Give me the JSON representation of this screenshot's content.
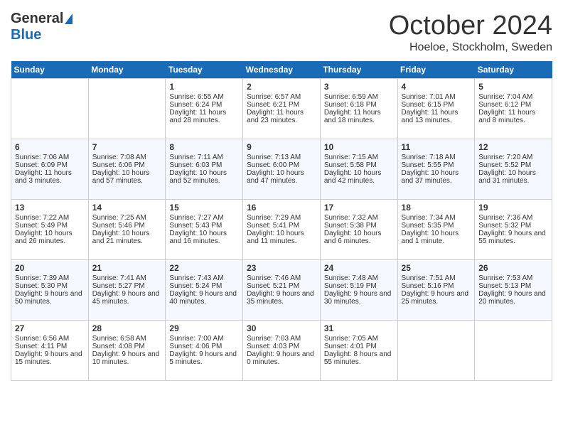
{
  "header": {
    "logo_general": "General",
    "logo_blue": "Blue",
    "month": "October 2024",
    "location": "Hoeloe, Stockholm, Sweden"
  },
  "days_of_week": [
    "Sunday",
    "Monday",
    "Tuesday",
    "Wednesday",
    "Thursday",
    "Friday",
    "Saturday"
  ],
  "weeks": [
    [
      {
        "day": "",
        "sunrise": "",
        "sunset": "",
        "daylight": ""
      },
      {
        "day": "",
        "sunrise": "",
        "sunset": "",
        "daylight": ""
      },
      {
        "day": "1",
        "sunrise": "Sunrise: 6:55 AM",
        "sunset": "Sunset: 6:24 PM",
        "daylight": "Daylight: 11 hours and 28 minutes."
      },
      {
        "day": "2",
        "sunrise": "Sunrise: 6:57 AM",
        "sunset": "Sunset: 6:21 PM",
        "daylight": "Daylight: 11 hours and 23 minutes."
      },
      {
        "day": "3",
        "sunrise": "Sunrise: 6:59 AM",
        "sunset": "Sunset: 6:18 PM",
        "daylight": "Daylight: 11 hours and 18 minutes."
      },
      {
        "day": "4",
        "sunrise": "Sunrise: 7:01 AM",
        "sunset": "Sunset: 6:15 PM",
        "daylight": "Daylight: 11 hours and 13 minutes."
      },
      {
        "day": "5",
        "sunrise": "Sunrise: 7:04 AM",
        "sunset": "Sunset: 6:12 PM",
        "daylight": "Daylight: 11 hours and 8 minutes."
      }
    ],
    [
      {
        "day": "6",
        "sunrise": "Sunrise: 7:06 AM",
        "sunset": "Sunset: 6:09 PM",
        "daylight": "Daylight: 11 hours and 3 minutes."
      },
      {
        "day": "7",
        "sunrise": "Sunrise: 7:08 AM",
        "sunset": "Sunset: 6:06 PM",
        "daylight": "Daylight: 10 hours and 57 minutes."
      },
      {
        "day": "8",
        "sunrise": "Sunrise: 7:11 AM",
        "sunset": "Sunset: 6:03 PM",
        "daylight": "Daylight: 10 hours and 52 minutes."
      },
      {
        "day": "9",
        "sunrise": "Sunrise: 7:13 AM",
        "sunset": "Sunset: 6:00 PM",
        "daylight": "Daylight: 10 hours and 47 minutes."
      },
      {
        "day": "10",
        "sunrise": "Sunrise: 7:15 AM",
        "sunset": "Sunset: 5:58 PM",
        "daylight": "Daylight: 10 hours and 42 minutes."
      },
      {
        "day": "11",
        "sunrise": "Sunrise: 7:18 AM",
        "sunset": "Sunset: 5:55 PM",
        "daylight": "Daylight: 10 hours and 37 minutes."
      },
      {
        "day": "12",
        "sunrise": "Sunrise: 7:20 AM",
        "sunset": "Sunset: 5:52 PM",
        "daylight": "Daylight: 10 hours and 31 minutes."
      }
    ],
    [
      {
        "day": "13",
        "sunrise": "Sunrise: 7:22 AM",
        "sunset": "Sunset: 5:49 PM",
        "daylight": "Daylight: 10 hours and 26 minutes."
      },
      {
        "day": "14",
        "sunrise": "Sunrise: 7:25 AM",
        "sunset": "Sunset: 5:46 PM",
        "daylight": "Daylight: 10 hours and 21 minutes."
      },
      {
        "day": "15",
        "sunrise": "Sunrise: 7:27 AM",
        "sunset": "Sunset: 5:43 PM",
        "daylight": "Daylight: 10 hours and 16 minutes."
      },
      {
        "day": "16",
        "sunrise": "Sunrise: 7:29 AM",
        "sunset": "Sunset: 5:41 PM",
        "daylight": "Daylight: 10 hours and 11 minutes."
      },
      {
        "day": "17",
        "sunrise": "Sunrise: 7:32 AM",
        "sunset": "Sunset: 5:38 PM",
        "daylight": "Daylight: 10 hours and 6 minutes."
      },
      {
        "day": "18",
        "sunrise": "Sunrise: 7:34 AM",
        "sunset": "Sunset: 5:35 PM",
        "daylight": "Daylight: 10 hours and 1 minute."
      },
      {
        "day": "19",
        "sunrise": "Sunrise: 7:36 AM",
        "sunset": "Sunset: 5:32 PM",
        "daylight": "Daylight: 9 hours and 55 minutes."
      }
    ],
    [
      {
        "day": "20",
        "sunrise": "Sunrise: 7:39 AM",
        "sunset": "Sunset: 5:30 PM",
        "daylight": "Daylight: 9 hours and 50 minutes."
      },
      {
        "day": "21",
        "sunrise": "Sunrise: 7:41 AM",
        "sunset": "Sunset: 5:27 PM",
        "daylight": "Daylight: 9 hours and 45 minutes."
      },
      {
        "day": "22",
        "sunrise": "Sunrise: 7:43 AM",
        "sunset": "Sunset: 5:24 PM",
        "daylight": "Daylight: 9 hours and 40 minutes."
      },
      {
        "day": "23",
        "sunrise": "Sunrise: 7:46 AM",
        "sunset": "Sunset: 5:21 PM",
        "daylight": "Daylight: 9 hours and 35 minutes."
      },
      {
        "day": "24",
        "sunrise": "Sunrise: 7:48 AM",
        "sunset": "Sunset: 5:19 PM",
        "daylight": "Daylight: 9 hours and 30 minutes."
      },
      {
        "day": "25",
        "sunrise": "Sunrise: 7:51 AM",
        "sunset": "Sunset: 5:16 PM",
        "daylight": "Daylight: 9 hours and 25 minutes."
      },
      {
        "day": "26",
        "sunrise": "Sunrise: 7:53 AM",
        "sunset": "Sunset: 5:13 PM",
        "daylight": "Daylight: 9 hours and 20 minutes."
      }
    ],
    [
      {
        "day": "27",
        "sunrise": "Sunrise: 6:56 AM",
        "sunset": "Sunset: 4:11 PM",
        "daylight": "Daylight: 9 hours and 15 minutes."
      },
      {
        "day": "28",
        "sunrise": "Sunrise: 6:58 AM",
        "sunset": "Sunset: 4:08 PM",
        "daylight": "Daylight: 9 hours and 10 minutes."
      },
      {
        "day": "29",
        "sunrise": "Sunrise: 7:00 AM",
        "sunset": "Sunset: 4:06 PM",
        "daylight": "Daylight: 9 hours and 5 minutes."
      },
      {
        "day": "30",
        "sunrise": "Sunrise: 7:03 AM",
        "sunset": "Sunset: 4:03 PM",
        "daylight": "Daylight: 9 hours and 0 minutes."
      },
      {
        "day": "31",
        "sunrise": "Sunrise: 7:05 AM",
        "sunset": "Sunset: 4:01 PM",
        "daylight": "Daylight: 8 hours and 55 minutes."
      },
      {
        "day": "",
        "sunrise": "",
        "sunset": "",
        "daylight": ""
      },
      {
        "day": "",
        "sunrise": "",
        "sunset": "",
        "daylight": ""
      }
    ]
  ]
}
